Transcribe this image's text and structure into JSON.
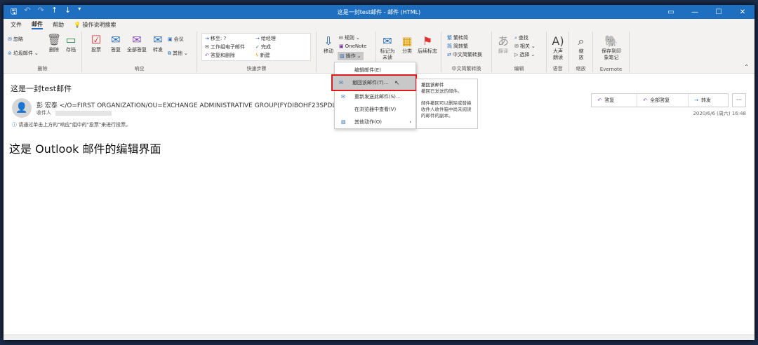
{
  "title": "这是一封test邮件 - 邮件 (HTML)",
  "tabs": [
    "文件",
    "邮件",
    "帮助"
  ],
  "search": "操作说明搜索",
  "ribbon": {
    "delete": {
      "ignore": "忽略",
      "junk": "垃圾邮件",
      "delete": "删除",
      "archive": "存档",
      "label": "删除"
    },
    "respond": {
      "vote": "投票",
      "reply": "答复",
      "replyall": "全部答复",
      "forward": "转发",
      "meeting": "会议",
      "other": "其他",
      "label": "响应"
    },
    "quicksteps": {
      "items": [
        "移至: ?",
        "工作组电子邮件",
        "答复和删除",
        "给经理",
        "完成",
        "新建"
      ],
      "label": "快速步骤"
    },
    "move": {
      "move": "移动",
      "rules": "规则",
      "onenote": "OneNote",
      "actions": "操作"
    },
    "tags": {
      "unread": "标记为未读",
      "category": "分类",
      "followup": "后续标志"
    },
    "convert": {
      "t2s": "繁转简",
      "s2t": "简转繁",
      "conv": "中文简繁转换",
      "label": "中文简繁转换"
    },
    "edit": {
      "translate": "翻译",
      "find": "查找",
      "related": "相关",
      "select": "选择",
      "label": "编辑"
    },
    "speech": {
      "read": "大声朗读",
      "label": "语音"
    },
    "zoom": {
      "zoom": "缩放",
      "label": "缩放"
    },
    "evernote": {
      "save": "保存到印象笔记",
      "label": "Evernote"
    }
  },
  "menu": [
    "编辑邮件(E)",
    "撤回该邮件(T)...",
    "重新发送此邮件(S)...",
    "在浏览器中查看(V)",
    "其他动作(O)"
  ],
  "tooltip": {
    "title": "撤回该邮件",
    "line1": "撤回已发送的邮件。",
    "line2": "邮件撤回可以删除或替换收件人收件箱中尚未阅读的邮件的副本。"
  },
  "mail": {
    "subject": "这是一封test邮件",
    "from": "彭 宏泰 </O=FIRST ORGANIZATION/OU=EXCHANGE ADMINISTRATIVE GROUP(FYDIBOHF23SPDLT)/",
    "to_label": "收件人",
    "info": "请通过单击上方的\"响应\"组中的\"投票\"来进行投票。",
    "body": "这是 Outlook 邮件的编辑界面",
    "date": "2020/6/6 (周六) 16:48"
  },
  "actions": {
    "reply": "答复",
    "replyall": "全部答复",
    "forward": "转发",
    "more": "···"
  }
}
